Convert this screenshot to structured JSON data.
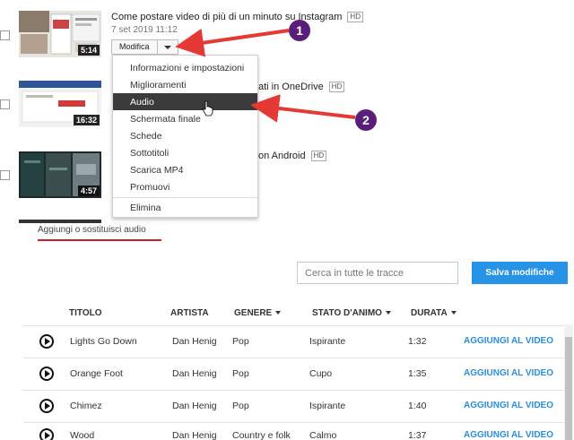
{
  "videos": [
    {
      "title": "Come postare video di più di un minuto su Instagram",
      "badge": "HD",
      "date": "7 set 2019 11:12",
      "duration": "5:14"
    },
    {
      "title": "ati in OneDrive",
      "badge": "HD",
      "duration": "16:32"
    },
    {
      "title": "on Android",
      "badge": "HD",
      "duration": "4:57"
    }
  ],
  "edit_button": {
    "label": "Modifica"
  },
  "menu": {
    "items": [
      "Informazioni e impostazioni",
      "Miglioramenti",
      "Audio",
      "Schermata finale",
      "Schede",
      "Sottotitoli",
      "Scarica MP4",
      "Promuovi"
    ],
    "last_item": "Elimina",
    "active": "Audio"
  },
  "annotations": {
    "badge1": "1",
    "badge2": "2",
    "color": "#5a1e7a",
    "arrow_color": "#e53935"
  },
  "tab": {
    "label": "Aggiungi o sostituisci audio"
  },
  "search": {
    "placeholder": "Cerca in tutte le tracce"
  },
  "save_button": {
    "label": "Salva modifiche"
  },
  "table": {
    "headers": {
      "title": "TITOLO",
      "artist": "ARTISTA",
      "genre": "GENERE",
      "mood": "STATO D'ANIMO",
      "duration": "DURATA"
    },
    "add_label": "AGGIUNGI AL VIDEO",
    "rows": [
      {
        "title": "Lights Go Down",
        "artist": "Dan Henig",
        "genre": "Pop",
        "mood": "Ispirante",
        "duration": "1:32"
      },
      {
        "title": "Orange Foot",
        "artist": "Dan Henig",
        "genre": "Pop",
        "mood": "Cupo",
        "duration": "1:35"
      },
      {
        "title": "Chimez",
        "artist": "Dan Henig",
        "genre": "Pop",
        "mood": "Ispirante",
        "duration": "1:40"
      },
      {
        "title": "Wood",
        "artist": "Dan Henig",
        "genre": "Country e folk",
        "mood": "Calmo",
        "duration": "1:37"
      }
    ]
  },
  "colors": {
    "accent": "#2793e6",
    "tab_underline": "#cc1f1f",
    "menu_active": "#3b3b3b"
  }
}
